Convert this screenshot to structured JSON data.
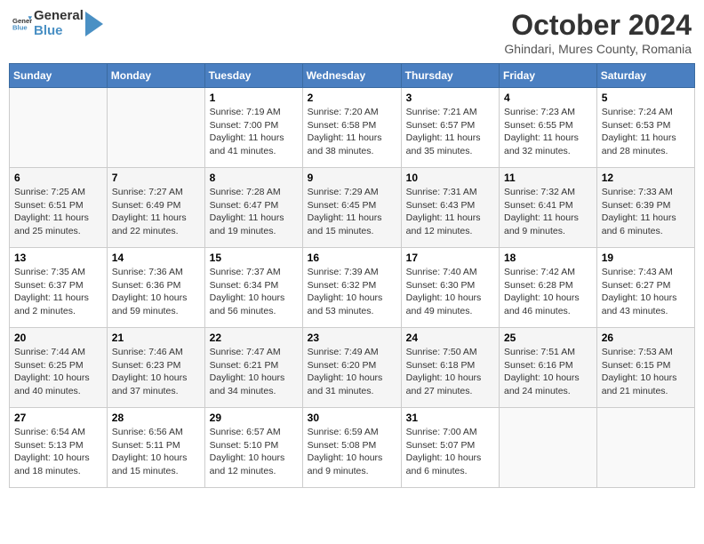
{
  "header": {
    "logo_general": "General",
    "logo_blue": "Blue",
    "month_year": "October 2024",
    "location": "Ghindari, Mures County, Romania"
  },
  "weekdays": [
    "Sunday",
    "Monday",
    "Tuesday",
    "Wednesday",
    "Thursday",
    "Friday",
    "Saturday"
  ],
  "weeks": [
    [
      {
        "day": "",
        "info": ""
      },
      {
        "day": "",
        "info": ""
      },
      {
        "day": "1",
        "sunrise": "7:19 AM",
        "sunset": "7:00 PM",
        "daylight": "11 hours and 41 minutes."
      },
      {
        "day": "2",
        "sunrise": "7:20 AM",
        "sunset": "6:58 PM",
        "daylight": "11 hours and 38 minutes."
      },
      {
        "day": "3",
        "sunrise": "7:21 AM",
        "sunset": "6:57 PM",
        "daylight": "11 hours and 35 minutes."
      },
      {
        "day": "4",
        "sunrise": "7:23 AM",
        "sunset": "6:55 PM",
        "daylight": "11 hours and 32 minutes."
      },
      {
        "day": "5",
        "sunrise": "7:24 AM",
        "sunset": "6:53 PM",
        "daylight": "11 hours and 28 minutes."
      }
    ],
    [
      {
        "day": "6",
        "sunrise": "7:25 AM",
        "sunset": "6:51 PM",
        "daylight": "11 hours and 25 minutes."
      },
      {
        "day": "7",
        "sunrise": "7:27 AM",
        "sunset": "6:49 PM",
        "daylight": "11 hours and 22 minutes."
      },
      {
        "day": "8",
        "sunrise": "7:28 AM",
        "sunset": "6:47 PM",
        "daylight": "11 hours and 19 minutes."
      },
      {
        "day": "9",
        "sunrise": "7:29 AM",
        "sunset": "6:45 PM",
        "daylight": "11 hours and 15 minutes."
      },
      {
        "day": "10",
        "sunrise": "7:31 AM",
        "sunset": "6:43 PM",
        "daylight": "11 hours and 12 minutes."
      },
      {
        "day": "11",
        "sunrise": "7:32 AM",
        "sunset": "6:41 PM",
        "daylight": "11 hours and 9 minutes."
      },
      {
        "day": "12",
        "sunrise": "7:33 AM",
        "sunset": "6:39 PM",
        "daylight": "11 hours and 6 minutes."
      }
    ],
    [
      {
        "day": "13",
        "sunrise": "7:35 AM",
        "sunset": "6:37 PM",
        "daylight": "11 hours and 2 minutes."
      },
      {
        "day": "14",
        "sunrise": "7:36 AM",
        "sunset": "6:36 PM",
        "daylight": "10 hours and 59 minutes."
      },
      {
        "day": "15",
        "sunrise": "7:37 AM",
        "sunset": "6:34 PM",
        "daylight": "10 hours and 56 minutes."
      },
      {
        "day": "16",
        "sunrise": "7:39 AM",
        "sunset": "6:32 PM",
        "daylight": "10 hours and 53 minutes."
      },
      {
        "day": "17",
        "sunrise": "7:40 AM",
        "sunset": "6:30 PM",
        "daylight": "10 hours and 49 minutes."
      },
      {
        "day": "18",
        "sunrise": "7:42 AM",
        "sunset": "6:28 PM",
        "daylight": "10 hours and 46 minutes."
      },
      {
        "day": "19",
        "sunrise": "7:43 AM",
        "sunset": "6:27 PM",
        "daylight": "10 hours and 43 minutes."
      }
    ],
    [
      {
        "day": "20",
        "sunrise": "7:44 AM",
        "sunset": "6:25 PM",
        "daylight": "10 hours and 40 minutes."
      },
      {
        "day": "21",
        "sunrise": "7:46 AM",
        "sunset": "6:23 PM",
        "daylight": "10 hours and 37 minutes."
      },
      {
        "day": "22",
        "sunrise": "7:47 AM",
        "sunset": "6:21 PM",
        "daylight": "10 hours and 34 minutes."
      },
      {
        "day": "23",
        "sunrise": "7:49 AM",
        "sunset": "6:20 PM",
        "daylight": "10 hours and 31 minutes."
      },
      {
        "day": "24",
        "sunrise": "7:50 AM",
        "sunset": "6:18 PM",
        "daylight": "10 hours and 27 minutes."
      },
      {
        "day": "25",
        "sunrise": "7:51 AM",
        "sunset": "6:16 PM",
        "daylight": "10 hours and 24 minutes."
      },
      {
        "day": "26",
        "sunrise": "7:53 AM",
        "sunset": "6:15 PM",
        "daylight": "10 hours and 21 minutes."
      }
    ],
    [
      {
        "day": "27",
        "sunrise": "6:54 AM",
        "sunset": "5:13 PM",
        "daylight": "10 hours and 18 minutes."
      },
      {
        "day": "28",
        "sunrise": "6:56 AM",
        "sunset": "5:11 PM",
        "daylight": "10 hours and 15 minutes."
      },
      {
        "day": "29",
        "sunrise": "6:57 AM",
        "sunset": "5:10 PM",
        "daylight": "10 hours and 12 minutes."
      },
      {
        "day": "30",
        "sunrise": "6:59 AM",
        "sunset": "5:08 PM",
        "daylight": "10 hours and 9 minutes."
      },
      {
        "day": "31",
        "sunrise": "7:00 AM",
        "sunset": "5:07 PM",
        "daylight": "10 hours and 6 minutes."
      },
      {
        "day": "",
        "info": ""
      },
      {
        "day": "",
        "info": ""
      }
    ]
  ]
}
